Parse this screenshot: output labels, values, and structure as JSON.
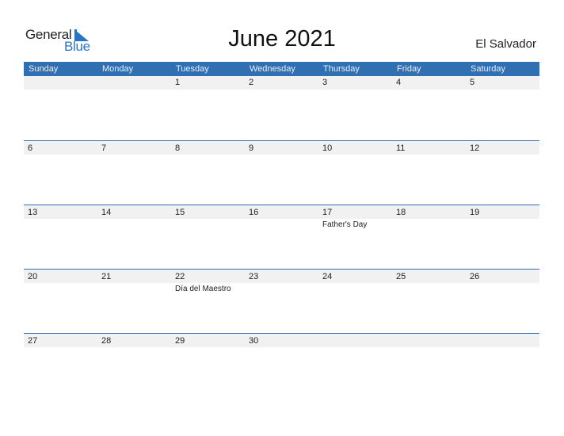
{
  "logo": {
    "word1": "General",
    "word2": "Blue"
  },
  "title": "June 2021",
  "country": "El Salvador",
  "colors": {
    "header_bg": "#2f6fb2",
    "band_bg": "#f1f1f1",
    "logo_blue": "#2a74c4"
  },
  "weekdays": [
    "Sunday",
    "Monday",
    "Tuesday",
    "Wednesday",
    "Thursday",
    "Friday",
    "Saturday"
  ],
  "weeks": [
    {
      "days": [
        {
          "date": "",
          "holiday": ""
        },
        {
          "date": "",
          "holiday": ""
        },
        {
          "date": "1",
          "holiday": ""
        },
        {
          "date": "2",
          "holiday": ""
        },
        {
          "date": "3",
          "holiday": ""
        },
        {
          "date": "4",
          "holiday": ""
        },
        {
          "date": "5",
          "holiday": ""
        }
      ]
    },
    {
      "days": [
        {
          "date": "6",
          "holiday": ""
        },
        {
          "date": "7",
          "holiday": ""
        },
        {
          "date": "8",
          "holiday": ""
        },
        {
          "date": "9",
          "holiday": ""
        },
        {
          "date": "10",
          "holiday": ""
        },
        {
          "date": "11",
          "holiday": ""
        },
        {
          "date": "12",
          "holiday": ""
        }
      ]
    },
    {
      "days": [
        {
          "date": "13",
          "holiday": ""
        },
        {
          "date": "14",
          "holiday": ""
        },
        {
          "date": "15",
          "holiday": ""
        },
        {
          "date": "16",
          "holiday": ""
        },
        {
          "date": "17",
          "holiday": "Father's Day"
        },
        {
          "date": "18",
          "holiday": ""
        },
        {
          "date": "19",
          "holiday": ""
        }
      ]
    },
    {
      "days": [
        {
          "date": "20",
          "holiday": ""
        },
        {
          "date": "21",
          "holiday": ""
        },
        {
          "date": "22",
          "holiday": "Día del Maestro"
        },
        {
          "date": "23",
          "holiday": ""
        },
        {
          "date": "24",
          "holiday": ""
        },
        {
          "date": "25",
          "holiday": ""
        },
        {
          "date": "26",
          "holiday": ""
        }
      ]
    },
    {
      "days": [
        {
          "date": "27",
          "holiday": ""
        },
        {
          "date": "28",
          "holiday": ""
        },
        {
          "date": "29",
          "holiday": ""
        },
        {
          "date": "30",
          "holiday": ""
        },
        {
          "date": "",
          "holiday": ""
        },
        {
          "date": "",
          "holiday": ""
        },
        {
          "date": "",
          "holiday": ""
        }
      ]
    }
  ]
}
